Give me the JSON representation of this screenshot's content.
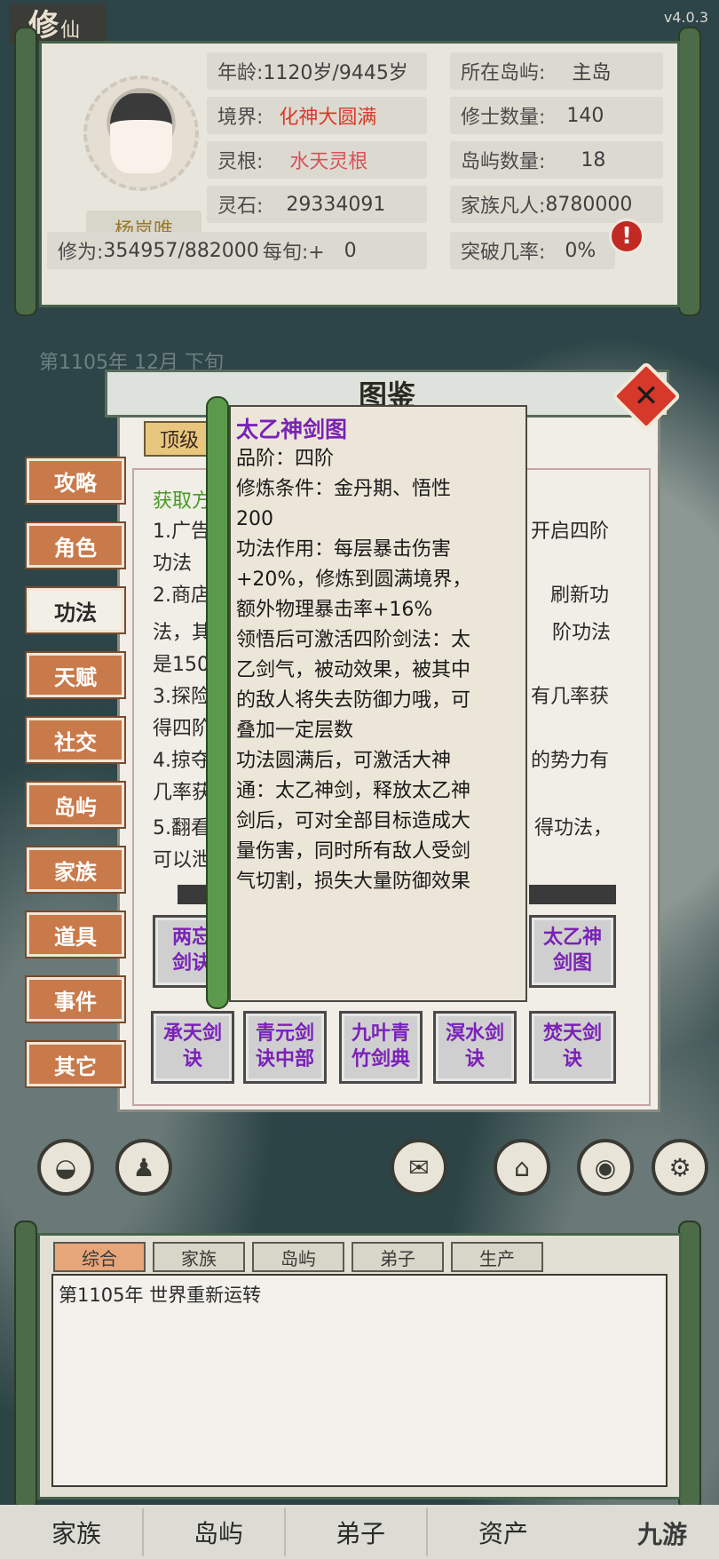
{
  "app": {
    "logo_big": "修",
    "logo_small": "仙",
    "version": "v4.0.3"
  },
  "character": {
    "name": "杨岚唯",
    "stats": [
      {
        "label": "年龄:",
        "value": "1120岁/9445岁"
      },
      {
        "label": "所在岛屿:",
        "value": "主岛"
      },
      {
        "label": "境界:",
        "value": "化神大圆满"
      },
      {
        "label": "修士数量:",
        "value": "140"
      },
      {
        "label": "灵根:",
        "value": "水天灵根"
      },
      {
        "label": "岛屿数量:",
        "value": "18"
      },
      {
        "label": "灵石:",
        "value": "29334091"
      },
      {
        "label": "家族凡人:",
        "value": "8780000"
      },
      {
        "label": "修为:",
        "value": "354957/882000"
      },
      {
        "label": "每旬:+",
        "value": "0"
      },
      {
        "label": "突破几率:",
        "value": "0%"
      }
    ],
    "alert_icon": "!",
    "date_text": "第1105年 12月 下旬"
  },
  "encyclopedia": {
    "title": "图鉴",
    "close_symbol": "✕",
    "top_tab": "顶级",
    "categories": [
      "攻略",
      "角色",
      "功法",
      "天赋",
      "社交",
      "岛屿",
      "家族",
      "道具",
      "事件",
      "其它"
    ],
    "active_category": "功法",
    "guide_lines": [
      "获取方",
      "1.广告",
      "开启四阶",
      "功法",
      "2.商店",
      "刷新功",
      "法，其",
      "阶功法",
      "是150",
      "3.探险",
      "有几率获",
      "得四阶",
      "4.掠夺",
      "的势力有",
      "几率获",
      "5.翻看",
      "得功法，",
      "可以泄"
    ],
    "skills": [
      {
        "name": "两忘剑诀"
      },
      {
        "name": "太乙神剑图"
      },
      {
        "name": "承天剑诀"
      },
      {
        "name": "青元剑诀中部"
      },
      {
        "name": "九叶青竹剑典"
      },
      {
        "name": "溟水剑诀"
      },
      {
        "name": "焚天剑诀"
      }
    ]
  },
  "tooltip": {
    "title": "太乙神剑图",
    "lines": [
      "品阶：四阶",
      "修炼条件：金丹期、悟性",
      "200",
      "功法作用：每层暴击伤害",
      "+20%，修炼到圆满境界，",
      "额外物理暴击率+16%",
      "领悟后可激活四阶剑法：太",
      "乙剑气，被动效果，被其中",
      "的敌人将失去防御力哦，可",
      "叠加一定层数",
      "功法圆满后，可激活大神",
      "通：太乙神剑，释放太乙神",
      "剑后，可对全部目标造成大",
      "量伤害，同时所有敌人受剑",
      "气切割，损失大量防御效果"
    ]
  },
  "icons": [
    "bag-icon",
    "person-icon",
    "mail-icon",
    "shop-icon",
    "location-icon",
    "gear-icon"
  ],
  "log": {
    "tabs": [
      "综合",
      "家族",
      "岛屿",
      "弟子",
      "生产"
    ],
    "active_tab": "综合",
    "entries": [
      "第1105年 世界重新运转"
    ]
  },
  "bottom_nav": [
    "家族",
    "岛屿",
    "弟子",
    "资产"
  ],
  "watermark": "九游"
}
